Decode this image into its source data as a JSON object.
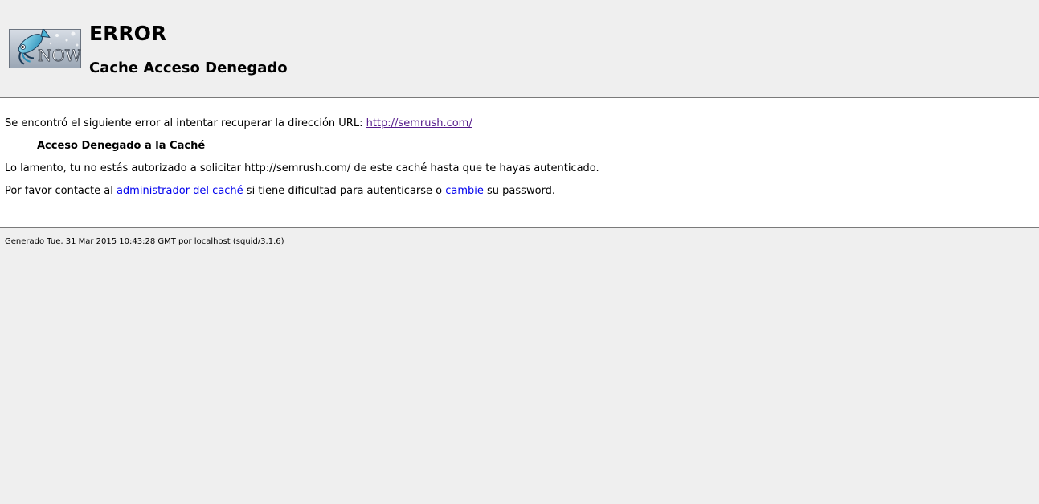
{
  "header": {
    "logo_alt": "squid NOW logo",
    "title": "ERROR",
    "subtitle": "Cache Acceso Denegado"
  },
  "content": {
    "line1_text": "Se encontró el siguiente error al intentar recuperar la dirección URL: ",
    "url_link": "http://semrush.com/",
    "error_heading": "Acceso Denegado a la Caché",
    "line3_text": "Lo lamento, tu no estás autorizado a solicitar http://semrush.com/ de este caché hasta que te hayas autenticado.",
    "line4_part1": "Por favor contacte al ",
    "admin_link": "administrador del caché",
    "line4_part2": " si tiene dificultad para autenticarse o ",
    "change_link": "cambie",
    "line4_part3": " su password."
  },
  "footer": {
    "text": "Generado Tue, 31 Mar 2015 10:43:28 GMT por localhost (squid/3.1.6)"
  },
  "colors": {
    "page_bg": "#efefef",
    "content_bg": "#ffffff",
    "link": "#0000ee",
    "visited_link": "#551a8b"
  }
}
